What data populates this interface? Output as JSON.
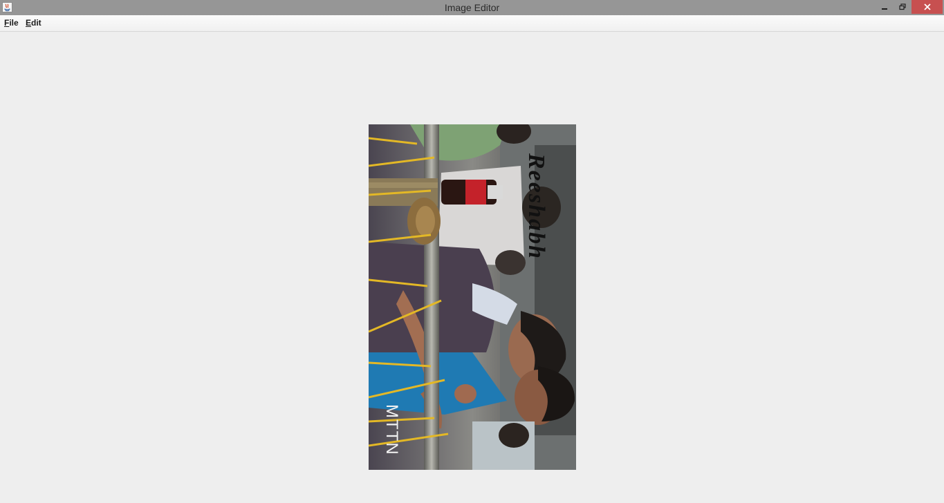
{
  "window": {
    "title": "Image Editor"
  },
  "menu": {
    "items": [
      {
        "label_first": "F",
        "label_rest": "ile"
      },
      {
        "label_first": "E",
        "label_rest": "dit"
      }
    ]
  },
  "image": {
    "watermark_text": "Reeshabh",
    "logo_text": "MTTN"
  }
}
